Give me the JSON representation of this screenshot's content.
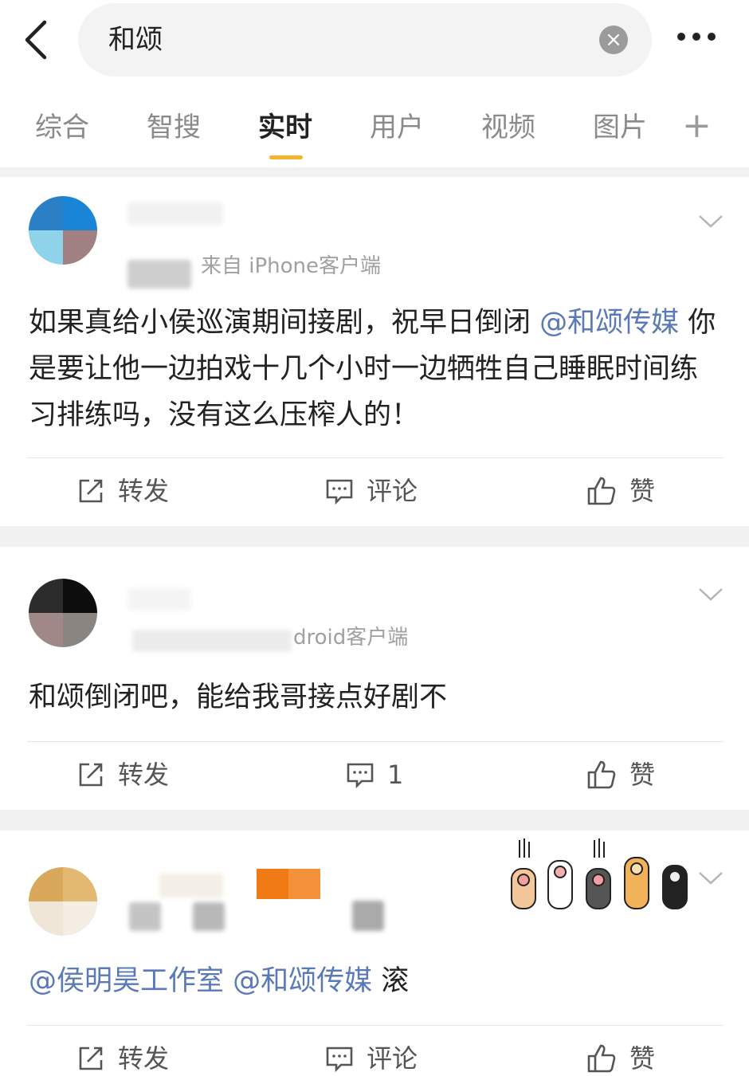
{
  "search": {
    "query": "和颂"
  },
  "tabs": [
    {
      "label": "综合"
    },
    {
      "label": "智搜"
    },
    {
      "label": "实时"
    },
    {
      "label": "用户"
    },
    {
      "label": "视频"
    },
    {
      "label": "图片"
    }
  ],
  "tab_plus": "+",
  "icons": {
    "back": "chevron-left-icon",
    "clear": "close-circle-icon",
    "more": "more-dots-icon",
    "repost": "repost-icon",
    "comment": "comment-icon",
    "like": "thumbs-up-icon",
    "expand": "chevron-down-icon"
  },
  "colors": {
    "accent": "#f7b32b",
    "mention": "#5a79b8"
  },
  "posts": [
    {
      "source": "来自 iPhone客户端",
      "content_parts": [
        {
          "text": "如果真给小侯巡演期间接剧，祝早日倒闭 ",
          "type": "text"
        },
        {
          "text": "@和颂传媒",
          "type": "mention"
        },
        {
          "text": " 你是要让他一边拍戏十几个小时一边牺牲自己睡眠时间练习排练吗，没有这么压榨人的！",
          "type": "text"
        }
      ],
      "actions": {
        "repost": "转发",
        "comment": "评论",
        "like": "赞"
      }
    },
    {
      "source": "droid客户端",
      "content_parts": [
        {
          "text": "和颂倒闭吧，能给我哥接点好剧不",
          "type": "text"
        }
      ],
      "actions": {
        "repost": "转发",
        "comment": "1",
        "like": "赞"
      }
    },
    {
      "source": "",
      "content_parts": [
        {
          "text": "@侯明昊工作室",
          "type": "mention"
        },
        {
          "text": " ",
          "type": "text"
        },
        {
          "text": "@和颂传媒",
          "type": "mention"
        },
        {
          "text": " 滚",
          "type": "text"
        }
      ],
      "actions": {
        "repost": "转发",
        "comment": "评论",
        "like": "赞"
      }
    }
  ]
}
